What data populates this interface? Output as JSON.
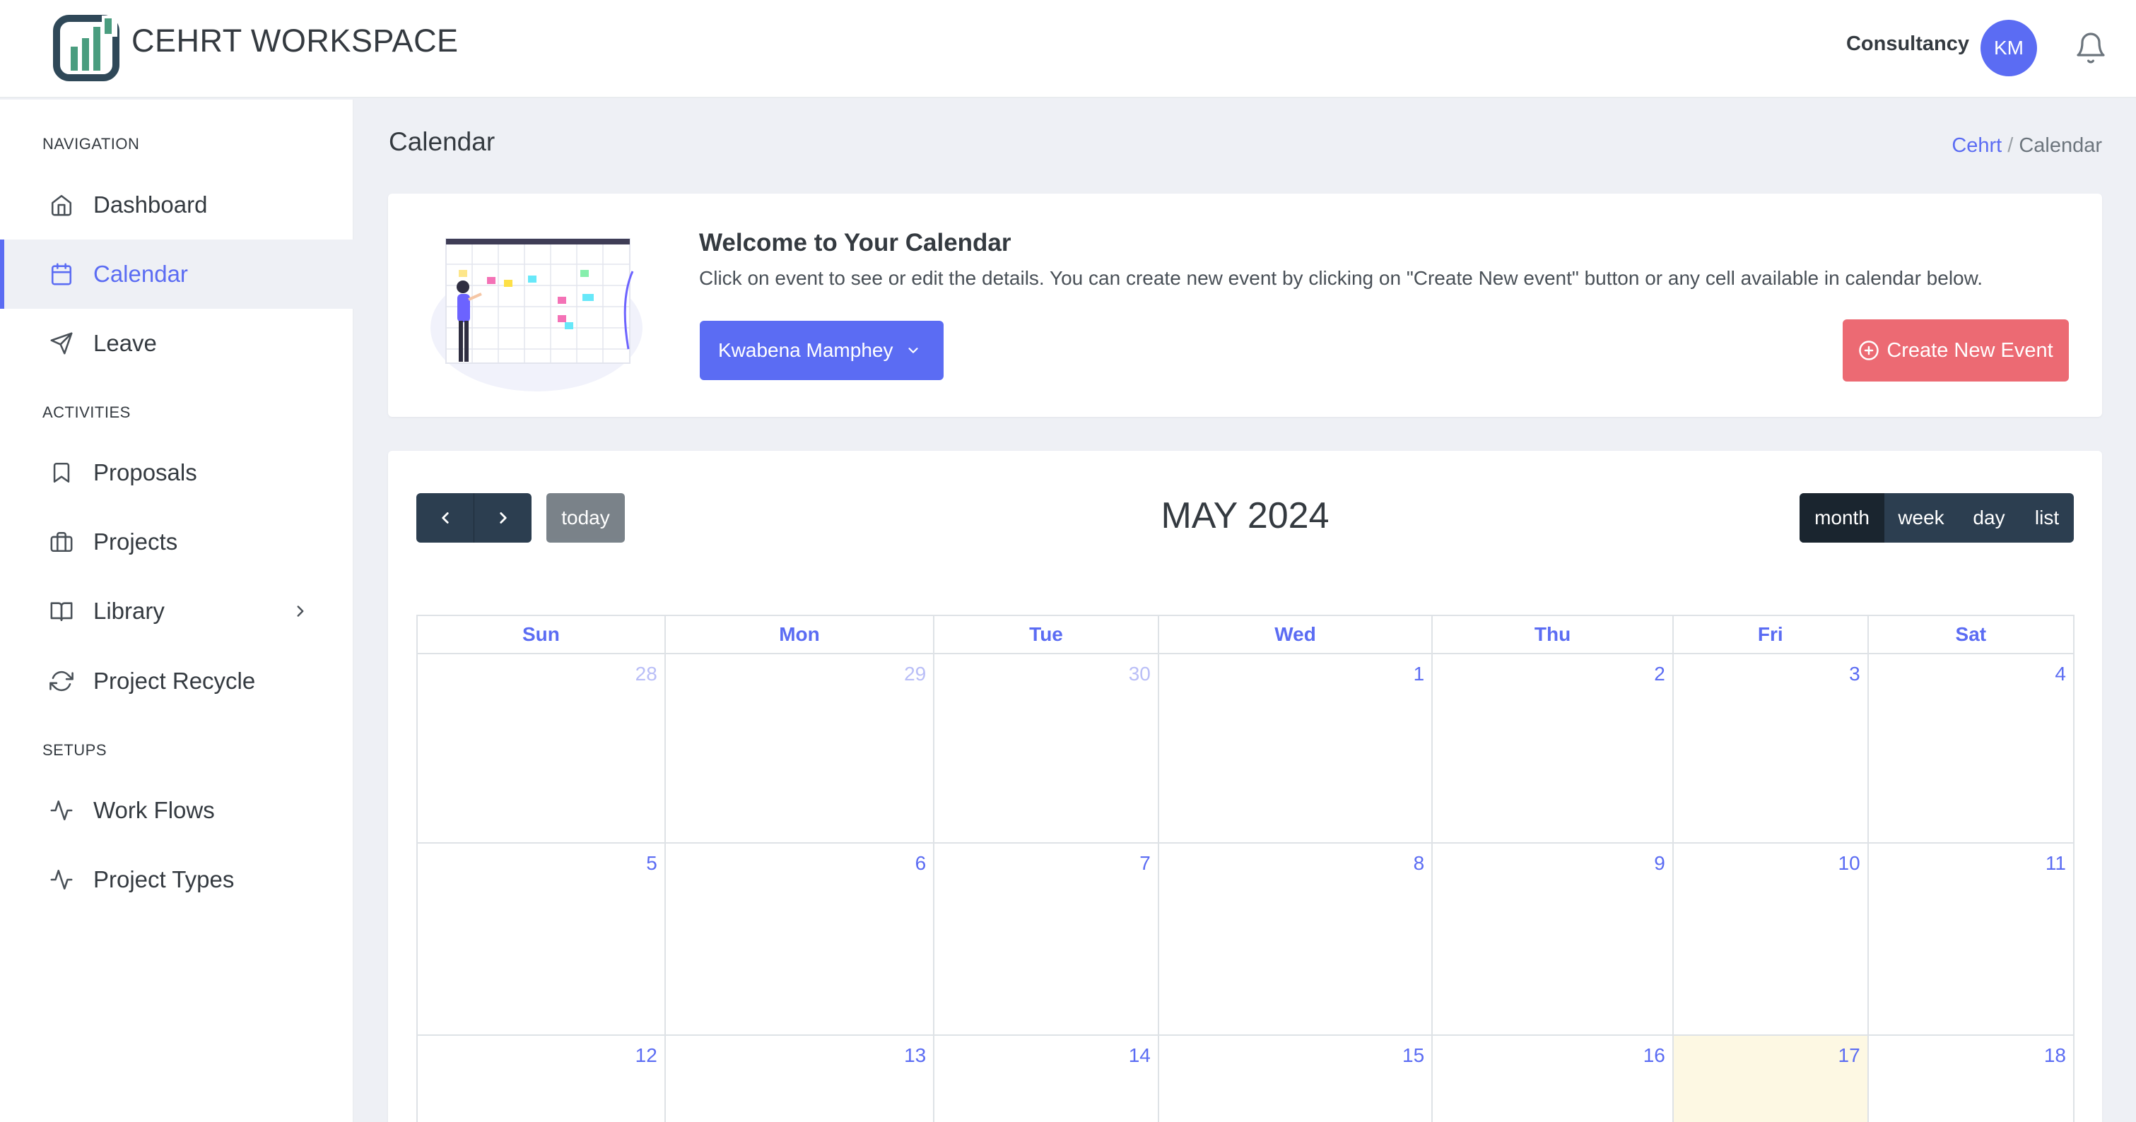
{
  "header": {
    "brand": "CEHRT WORKSPACE",
    "org": "Consultancy",
    "avatar_initials": "KM"
  },
  "sidebar": {
    "sections": {
      "navigation": "NAVIGATION",
      "activities": "ACTIVITIES",
      "setups": "SETUPS"
    },
    "items": [
      {
        "label": "Dashboard",
        "icon": "home-icon",
        "active": false
      },
      {
        "label": "Calendar",
        "icon": "calendar-icon",
        "active": true
      },
      {
        "label": "Leave",
        "icon": "send-icon",
        "active": false
      },
      {
        "label": "Proposals",
        "icon": "bookmark-icon",
        "active": false
      },
      {
        "label": "Projects",
        "icon": "briefcase-icon",
        "active": false
      },
      {
        "label": "Library",
        "icon": "book-icon",
        "active": false
      },
      {
        "label": "Project Recycle",
        "icon": "refresh-icon",
        "active": false
      },
      {
        "label": "Work Flows",
        "icon": "activity-icon",
        "active": false
      },
      {
        "label": "Project Types",
        "icon": "activity-icon",
        "active": false
      }
    ]
  },
  "page": {
    "title": "Calendar",
    "breadcrumb": {
      "root": "Cehrt",
      "sep": "/",
      "current": "Calendar"
    }
  },
  "welcome": {
    "title": "Welcome to Your Calendar",
    "text": "Click on event to see or edit the details. You can create new event by clicking on \"Create New event\" button or any cell available in calendar below.",
    "user_select": "Kwabena Mamphey",
    "create_button": "Create New Event"
  },
  "calendar": {
    "title": "MAY 2024",
    "today_label": "today",
    "views": [
      "month",
      "week",
      "day",
      "list"
    ],
    "active_view": "month",
    "weekdays": [
      "Sun",
      "Mon",
      "Tue",
      "Wed",
      "Thu",
      "Fri",
      "Sat"
    ],
    "weeks": [
      [
        "28",
        "29",
        "30",
        "1",
        "2",
        "3",
        "4"
      ],
      [
        "5",
        "6",
        "7",
        "8",
        "9",
        "10",
        "11"
      ],
      [
        "12",
        "13",
        "14",
        "15",
        "16",
        "17",
        "18"
      ]
    ],
    "today_day": "17",
    "accent_color": "#5b6cf3",
    "create_color": "#ec6a73"
  }
}
